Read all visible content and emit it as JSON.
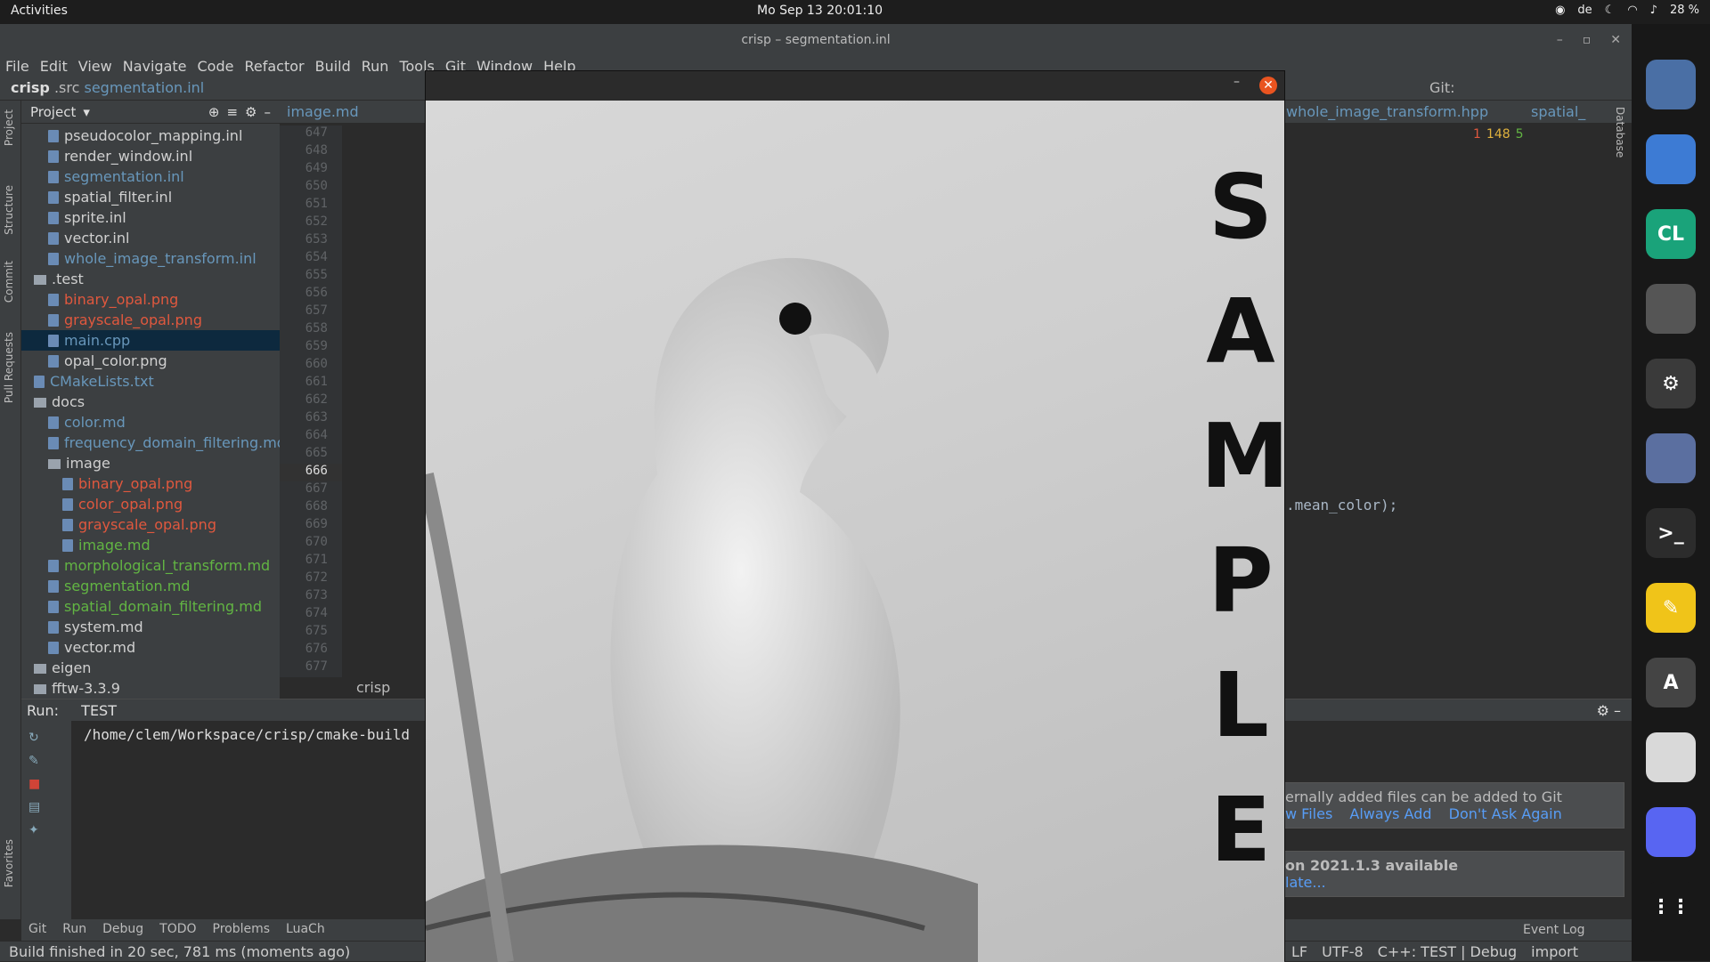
{
  "topbar": {
    "activities": "Activities",
    "clock": "Mo Sep 13  20:01:10",
    "lang": "de",
    "battery": "28 %"
  },
  "window": {
    "title": "crisp – segmentation.inl"
  },
  "menu": [
    "File",
    "Edit",
    "View",
    "Navigate",
    "Code",
    "Refactor",
    "Build",
    "Run",
    "Tools",
    "Git",
    "Window",
    "Help"
  ],
  "breadcrumb": {
    "project": "crisp",
    "src": ".src",
    "file": "segmentation.inl"
  },
  "project": {
    "title": "Project",
    "items": [
      {
        "t": "pseudocolor_mapping.inl",
        "c": "c-white",
        "i": 1,
        "k": "fi"
      },
      {
        "t": "render_window.inl",
        "c": "c-white",
        "i": 1,
        "k": "fi"
      },
      {
        "t": "segmentation.inl",
        "c": "c-blue",
        "i": 1,
        "k": "fi"
      },
      {
        "t": "spatial_filter.inl",
        "c": "c-white",
        "i": 1,
        "k": "fi"
      },
      {
        "t": "sprite.inl",
        "c": "c-white",
        "i": 1,
        "k": "fi"
      },
      {
        "t": "vector.inl",
        "c": "c-white",
        "i": 1,
        "k": "fi"
      },
      {
        "t": "whole_image_transform.inl",
        "c": "c-blue",
        "i": 1,
        "k": "fi"
      },
      {
        "t": ".test",
        "c": "c-white",
        "i": 0,
        "k": "fo"
      },
      {
        "t": "binary_opal.png",
        "c": "c-red",
        "i": 1,
        "k": "fi"
      },
      {
        "t": "grayscale_opal.png",
        "c": "c-red",
        "i": 1,
        "k": "fi"
      },
      {
        "t": "main.cpp",
        "c": "c-blue",
        "i": 1,
        "k": "fi",
        "sel": true
      },
      {
        "t": "opal_color.png",
        "c": "c-white",
        "i": 1,
        "k": "fi"
      },
      {
        "t": "CMakeLists.txt",
        "c": "c-blue",
        "i": 0,
        "k": "fi"
      },
      {
        "t": "docs",
        "c": "c-white",
        "i": 0,
        "k": "fo"
      },
      {
        "t": "color.md",
        "c": "c-blue",
        "i": 1,
        "k": "fi"
      },
      {
        "t": "frequency_domain_filtering.md",
        "c": "c-blue",
        "i": 1,
        "k": "fi"
      },
      {
        "t": "image",
        "c": "c-white",
        "i": 1,
        "k": "fo"
      },
      {
        "t": "binary_opal.png",
        "c": "c-red",
        "i": 2,
        "k": "fi"
      },
      {
        "t": "color_opal.png",
        "c": "c-red",
        "i": 2,
        "k": "fi"
      },
      {
        "t": "grayscale_opal.png",
        "c": "c-red",
        "i": 2,
        "k": "fi"
      },
      {
        "t": "image.md",
        "c": "c-green",
        "i": 2,
        "k": "fi"
      },
      {
        "t": "morphological_transform.md",
        "c": "c-green",
        "i": 1,
        "k": "fi"
      },
      {
        "t": "segmentation.md",
        "c": "c-green",
        "i": 1,
        "k": "fi"
      },
      {
        "t": "spatial_domain_filtering.md",
        "c": "c-green",
        "i": 1,
        "k": "fi"
      },
      {
        "t": "system.md",
        "c": "c-white",
        "i": 1,
        "k": "fi"
      },
      {
        "t": "vector.md",
        "c": "c-white",
        "i": 1,
        "k": "fi"
      },
      {
        "t": "eigen",
        "c": "c-white",
        "i": 0,
        "k": "fo"
      },
      {
        "t": "fftw-3.3.9",
        "c": "c-white",
        "i": 0,
        "k": "fo"
      }
    ]
  },
  "editor": {
    "tab1": "image.md",
    "tab_right": "whole_image_transform.hpp",
    "tab_right2": "spatial_",
    "lines": [
      "647",
      "648",
      "649",
      "650",
      "651",
      "652",
      "653",
      "654",
      "655",
      "656",
      "657",
      "658",
      "659",
      "660",
      "661",
      "662",
      "663",
      "664",
      "665",
      "666",
      "667",
      "668",
      "669",
      "670",
      "671",
      "672",
      "673",
      "674",
      "675",
      "676",
      "677"
    ],
    "code_fragment": ".mean_color);",
    "breadcrumb": "crisp",
    "inspections": {
      "errors": "1",
      "warnings": "148",
      "ok": "5"
    }
  },
  "run": {
    "label": "Run:",
    "tab": "TEST",
    "path": "/home/clem/Workspace/crisp/cmake-build"
  },
  "notifications": [
    {
      "text": "ernally added files can be added to Git",
      "links": [
        "w Files",
        "Always Add",
        "Don't Ask Again"
      ]
    },
    {
      "text": "on 2021.1.3 available",
      "links": [
        "late..."
      ]
    }
  ],
  "bottom_tabs": [
    "Git",
    "Run",
    "Debug",
    "TODO",
    "Problems",
    "LuaCh"
  ],
  "event_log": "Event Log",
  "status": {
    "left": "Build finished in 20 sec, 781 ms (moments ago)",
    "lf": "LF",
    "enc": "UTF-8",
    "ctx": "C++: TEST | Debug",
    "import": "import"
  },
  "left_tools": [
    "Project",
    "Structure",
    "Commit",
    "Pull Requests",
    "Favorites"
  ],
  "right_tools": [
    "Database"
  ],
  "git_label": "Git:",
  "viewer": {
    "watermark": [
      "S",
      "A",
      "M",
      "P",
      "L",
      "E"
    ]
  },
  "dock": [
    {
      "name": "budgie-icon",
      "color": "#4a6fa5",
      "label": ""
    },
    {
      "name": "chromium-icon",
      "color": "#3d7bd4",
      "label": ""
    },
    {
      "name": "clion-icon",
      "color": "#1aa37a",
      "label": "CL"
    },
    {
      "name": "gimp-icon",
      "color": "#555555",
      "label": ""
    },
    {
      "name": "settings-icon",
      "color": "#3a3a3a",
      "label": "⚙"
    },
    {
      "name": "krita-icon",
      "color": "#5b6fa0",
      "label": ""
    },
    {
      "name": "terminal-icon",
      "color": "#2c2c2c",
      "label": ">_"
    },
    {
      "name": "text-editor-icon",
      "color": "#f0c419",
      "label": "✎"
    },
    {
      "name": "software-updater-icon",
      "color": "#444444",
      "label": "A"
    },
    {
      "name": "document-viewer-icon",
      "color": "#d9d9d9",
      "label": ""
    },
    {
      "name": "discord-icon",
      "color": "#5865f2",
      "label": ""
    },
    {
      "name": "app-grid-icon",
      "color": "#181818",
      "label": "⋮⋮"
    }
  ]
}
